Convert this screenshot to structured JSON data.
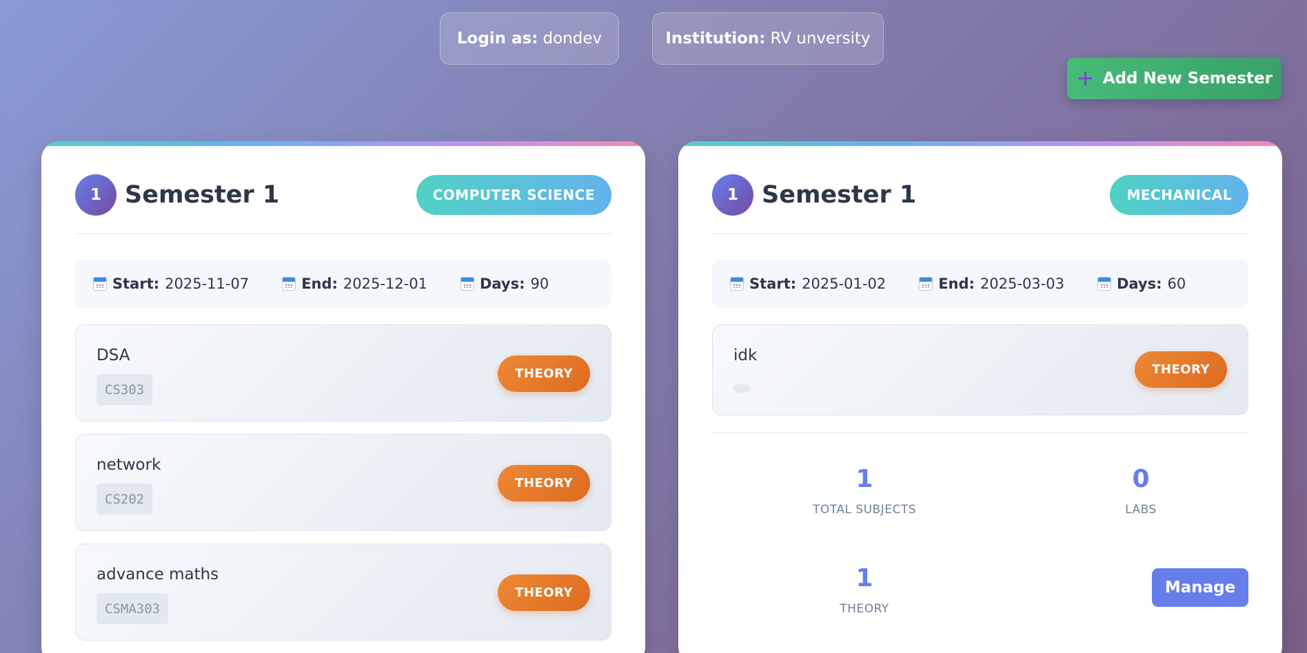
{
  "header": {
    "login_label": "Login as:",
    "login_value": "dondev",
    "institution_label": "Institution:",
    "institution_value": "RV unversity",
    "add_button_label": "Add New Semester"
  },
  "semesters": [
    {
      "number": "1",
      "title": "Semester 1",
      "department": "COMPUTER SCIENCE",
      "start_label": "Start:",
      "start": "2025-11-07",
      "end_label": "End:",
      "end": "2025-12-01",
      "days_label": "Days:",
      "days": "90",
      "subjects": [
        {
          "name": "DSA",
          "code": "CS303",
          "type": "THEORY"
        },
        {
          "name": "network",
          "code": "CS202",
          "type": "THEORY"
        },
        {
          "name": "advance maths",
          "code": "CSMA303",
          "type": "THEORY"
        }
      ]
    },
    {
      "number": "1",
      "title": "Semester 1",
      "department": "MECHANICAL",
      "start_label": "Start:",
      "start": "2025-01-02",
      "end_label": "End:",
      "end": "2025-03-03",
      "days_label": "Days:",
      "days": "60",
      "subjects": [
        {
          "name": "idk",
          "code": "",
          "type": "THEORY"
        }
      ],
      "stats": {
        "total_subjects_value": "1",
        "total_subjects_label": "TOTAL SUBJECTS",
        "labs_value": "0",
        "labs_label": "LABS",
        "theory_value": "1",
        "theory_label": "THEORY"
      },
      "manage_label": "Manage"
    }
  ],
  "icons": {
    "add": "plus-icon",
    "date": "calendar-icon"
  },
  "colors": {
    "accent": "#667eea",
    "add_button": "#48bb78",
    "theory_badge": "#ed8936",
    "department_badge": "#4fd1c5"
  }
}
